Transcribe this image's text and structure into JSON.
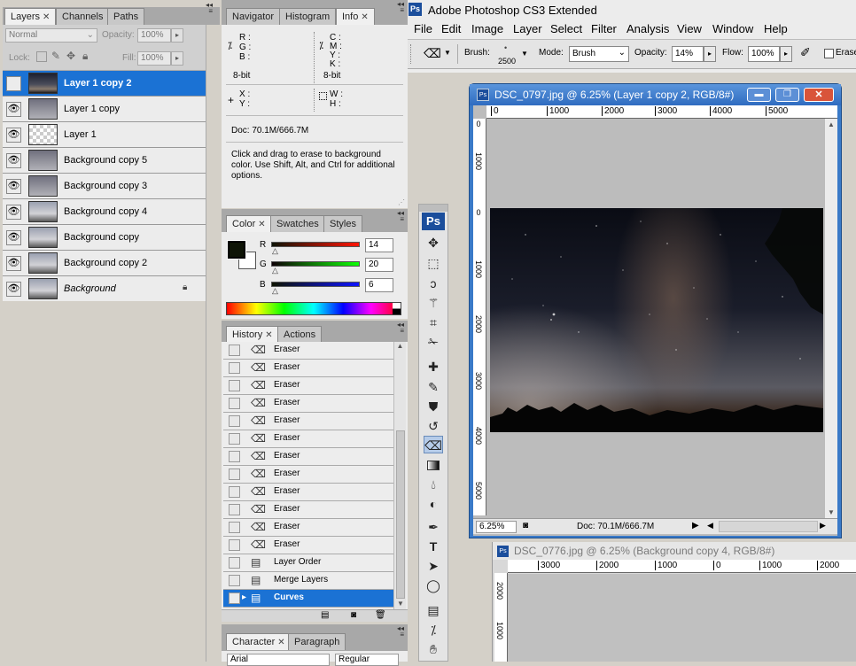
{
  "layers_panel": {
    "tabs": [
      "Layers",
      "Channels",
      "Paths"
    ],
    "blend_mode": "Normal",
    "opacity_label": "Opacity:",
    "opacity_value": "100%",
    "lock_label": "Lock:",
    "fill_label": "Fill:",
    "fill_value": "100%",
    "layers": [
      {
        "name": "Layer 1 copy 2",
        "selected": true,
        "visible": false
      },
      {
        "name": "Layer 1 copy",
        "selected": false,
        "visible": true
      },
      {
        "name": "Layer 1",
        "selected": false,
        "visible": true
      },
      {
        "name": "Background copy 5",
        "selected": false,
        "visible": true
      },
      {
        "name": "Background copy 3",
        "selected": false,
        "visible": true
      },
      {
        "name": "Background copy 4",
        "selected": false,
        "visible": true
      },
      {
        "name": "Background copy",
        "selected": false,
        "visible": true
      },
      {
        "name": "Background copy 2",
        "selected": false,
        "visible": true
      },
      {
        "name": "Background",
        "selected": false,
        "visible": true,
        "locked": true
      }
    ]
  },
  "info_panel": {
    "tabs": [
      "Navigator",
      "Histogram",
      "Info"
    ],
    "r": "R :",
    "g": "G :",
    "b": "B :",
    "c": "C :",
    "m": "M :",
    "y": "Y :",
    "k": "K :",
    "bits_left": "8-bit",
    "bits_right": "8-bit",
    "x": "X :",
    "yy": "Y :",
    "w": "W :",
    "h": "H :",
    "doc": "Doc: 70.1M/666.7M",
    "hint": "Click and drag to erase to background color.  Use Shift, Alt, and Ctrl for additional options."
  },
  "color_panel": {
    "tabs": [
      "Color",
      "Swatches",
      "Styles"
    ],
    "r_label": "R",
    "g_label": "G",
    "b_label": "B",
    "r_value": "14",
    "g_value": "20",
    "b_value": "6"
  },
  "history_panel": {
    "tabs": [
      "History",
      "Actions"
    ],
    "items": [
      {
        "name": "Eraser",
        "icon": "eraser-icon"
      },
      {
        "name": "Eraser",
        "icon": "eraser-icon"
      },
      {
        "name": "Eraser",
        "icon": "eraser-icon"
      },
      {
        "name": "Eraser",
        "icon": "eraser-icon"
      },
      {
        "name": "Eraser",
        "icon": "eraser-icon"
      },
      {
        "name": "Eraser",
        "icon": "eraser-icon"
      },
      {
        "name": "Eraser",
        "icon": "eraser-icon"
      },
      {
        "name": "Eraser",
        "icon": "eraser-icon"
      },
      {
        "name": "Eraser",
        "icon": "eraser-icon"
      },
      {
        "name": "Eraser",
        "icon": "eraser-icon"
      },
      {
        "name": "Eraser",
        "icon": "eraser-icon"
      },
      {
        "name": "Eraser",
        "icon": "eraser-icon"
      },
      {
        "name": "Layer Order",
        "icon": "document-icon"
      },
      {
        "name": "Merge Layers",
        "icon": "document-icon"
      },
      {
        "name": "Curves",
        "icon": "document-icon",
        "selected": true
      }
    ]
  },
  "character_panel": {
    "tabs": [
      "Character",
      "Paragraph"
    ],
    "font": "Arial",
    "style": "Regular"
  },
  "app": {
    "title": "Adobe Photoshop CS3 Extended",
    "menu": [
      "File",
      "Edit",
      "Image",
      "Layer",
      "Select",
      "Filter",
      "Analysis",
      "View",
      "Window",
      "Help"
    ],
    "ps_logo": "Ps"
  },
  "options_bar": {
    "brush_label": "Brush:",
    "brush_size": "2500",
    "mode_label": "Mode:",
    "mode_value": "Brush",
    "opacity_label": "Opacity:",
    "opacity_value": "14%",
    "flow_label": "Flow:",
    "flow_value": "100%",
    "erase_label": "Erase"
  },
  "document": {
    "title": "DSC_0797.jpg @ 6.25% (Layer 1 copy 2, RGB/8#)",
    "ruler_h": [
      "0",
      "1000",
      "2000",
      "3000",
      "4000",
      "5000"
    ],
    "ruler_v": [
      "0",
      "1000",
      "0",
      "1000",
      "2000",
      "3000",
      "4000",
      "5000"
    ],
    "zoom": "6.25%",
    "status": "Doc: 70.1M/666.7M"
  },
  "document2": {
    "title": "DSC_0776.jpg @ 6.25% (Background copy 4, RGB/8#)",
    "ruler_h": [
      "3000",
      "2000",
      "1000",
      "0",
      "1000",
      "2000"
    ],
    "ruler_v": [
      "2000",
      "1000"
    ]
  }
}
